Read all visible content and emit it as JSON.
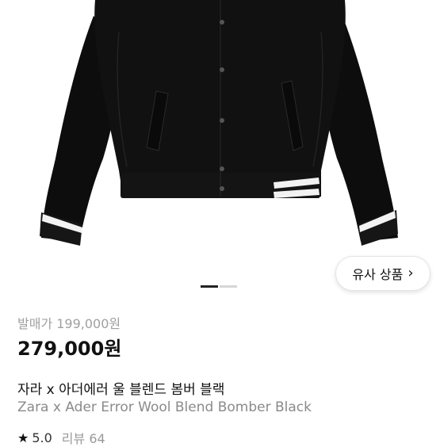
{
  "product": {
    "similar_button_label": "유사 상품",
    "release_price_label": "발매가 199,000원",
    "price": "279,000원",
    "title_ko": "자라 x 아더에러 울 블렌드 봄버 블랙",
    "title_en": "Zara x Ader Error Wool Blend Bomber Black",
    "rating": "5.0",
    "review_label": "리뷰 64"
  },
  "carousel": {
    "total": 2,
    "active_index": 1
  },
  "colors": {
    "accent": "#111111",
    "muted": "#a0a0a0"
  },
  "icons": {
    "similar_chevron": "chevron-right-icon",
    "rating_star": "star-icon"
  }
}
